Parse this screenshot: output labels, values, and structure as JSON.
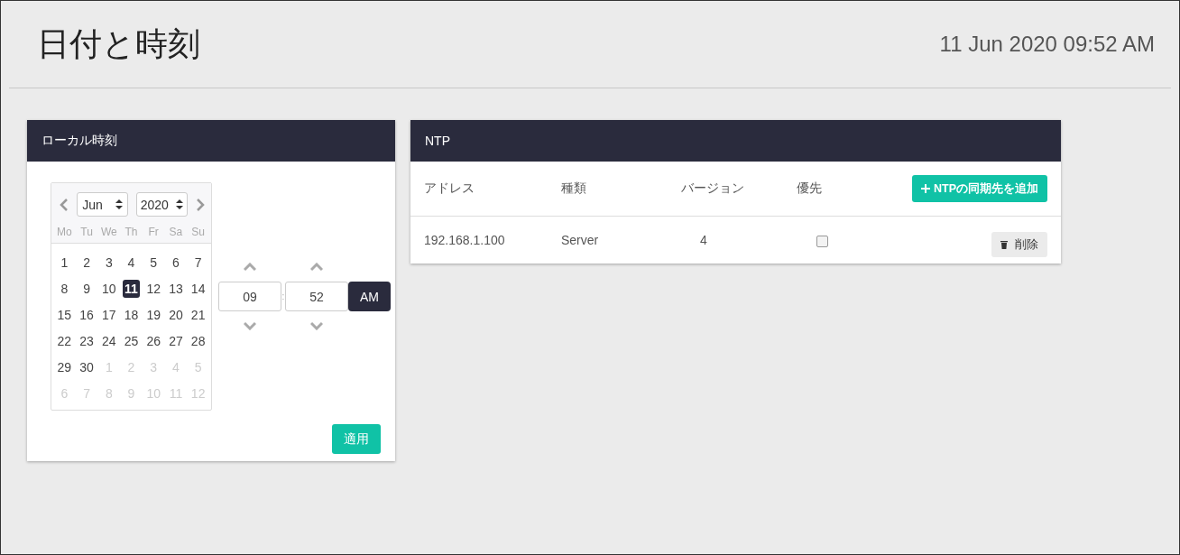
{
  "page": {
    "title": "日付と時刻",
    "datetime": "11 Jun 2020 09:52 AM"
  },
  "local_time": {
    "title": "ローカル時刻",
    "calendar": {
      "month": "Jun",
      "year": "2020",
      "weekdays": [
        "Mo",
        "Tu",
        "We",
        "Th",
        "Fr",
        "Sa",
        "Su"
      ],
      "days": [
        {
          "label": "1",
          "other_month": false,
          "selected": false
        },
        {
          "label": "2",
          "other_month": false,
          "selected": false
        },
        {
          "label": "3",
          "other_month": false,
          "selected": false
        },
        {
          "label": "4",
          "other_month": false,
          "selected": false
        },
        {
          "label": "5",
          "other_month": false,
          "selected": false
        },
        {
          "label": "6",
          "other_month": false,
          "selected": false
        },
        {
          "label": "7",
          "other_month": false,
          "selected": false
        },
        {
          "label": "8",
          "other_month": false,
          "selected": false
        },
        {
          "label": "9",
          "other_month": false,
          "selected": false
        },
        {
          "label": "10",
          "other_month": false,
          "selected": false
        },
        {
          "label": "11",
          "other_month": false,
          "selected": true
        },
        {
          "label": "12",
          "other_month": false,
          "selected": false
        },
        {
          "label": "13",
          "other_month": false,
          "selected": false
        },
        {
          "label": "14",
          "other_month": false,
          "selected": false
        },
        {
          "label": "15",
          "other_month": false,
          "selected": false
        },
        {
          "label": "16",
          "other_month": false,
          "selected": false
        },
        {
          "label": "17",
          "other_month": false,
          "selected": false
        },
        {
          "label": "18",
          "other_month": false,
          "selected": false
        },
        {
          "label": "19",
          "other_month": false,
          "selected": false
        },
        {
          "label": "20",
          "other_month": false,
          "selected": false
        },
        {
          "label": "21",
          "other_month": false,
          "selected": false
        },
        {
          "label": "22",
          "other_month": false,
          "selected": false
        },
        {
          "label": "23",
          "other_month": false,
          "selected": false
        },
        {
          "label": "24",
          "other_month": false,
          "selected": false
        },
        {
          "label": "25",
          "other_month": false,
          "selected": false
        },
        {
          "label": "26",
          "other_month": false,
          "selected": false
        },
        {
          "label": "27",
          "other_month": false,
          "selected": false
        },
        {
          "label": "28",
          "other_month": false,
          "selected": false
        },
        {
          "label": "29",
          "other_month": false,
          "selected": false
        },
        {
          "label": "30",
          "other_month": false,
          "selected": false
        },
        {
          "label": "1",
          "other_month": true,
          "selected": false
        },
        {
          "label": "2",
          "other_month": true,
          "selected": false
        },
        {
          "label": "3",
          "other_month": true,
          "selected": false
        },
        {
          "label": "4",
          "other_month": true,
          "selected": false
        },
        {
          "label": "5",
          "other_month": true,
          "selected": false
        },
        {
          "label": "6",
          "other_month": true,
          "selected": false
        },
        {
          "label": "7",
          "other_month": true,
          "selected": false
        },
        {
          "label": "8",
          "other_month": true,
          "selected": false
        },
        {
          "label": "9",
          "other_month": true,
          "selected": false
        },
        {
          "label": "10",
          "other_month": true,
          "selected": false
        },
        {
          "label": "11",
          "other_month": true,
          "selected": false
        },
        {
          "label": "12",
          "other_month": true,
          "selected": false
        }
      ]
    },
    "hour": "09",
    "separator": ":",
    "minute": "52",
    "meridiem": "AM",
    "apply_button": "適用"
  },
  "ntp": {
    "title": "NTP",
    "columns": [
      "アドレス",
      "種類",
      "バージョン",
      "優先"
    ],
    "add_button": "NTPの同期先を追加",
    "rows": [
      {
        "address": "192.168.1.100",
        "type": "Server",
        "version": "4",
        "prefer": false,
        "delete_button": "削除"
      }
    ]
  }
}
